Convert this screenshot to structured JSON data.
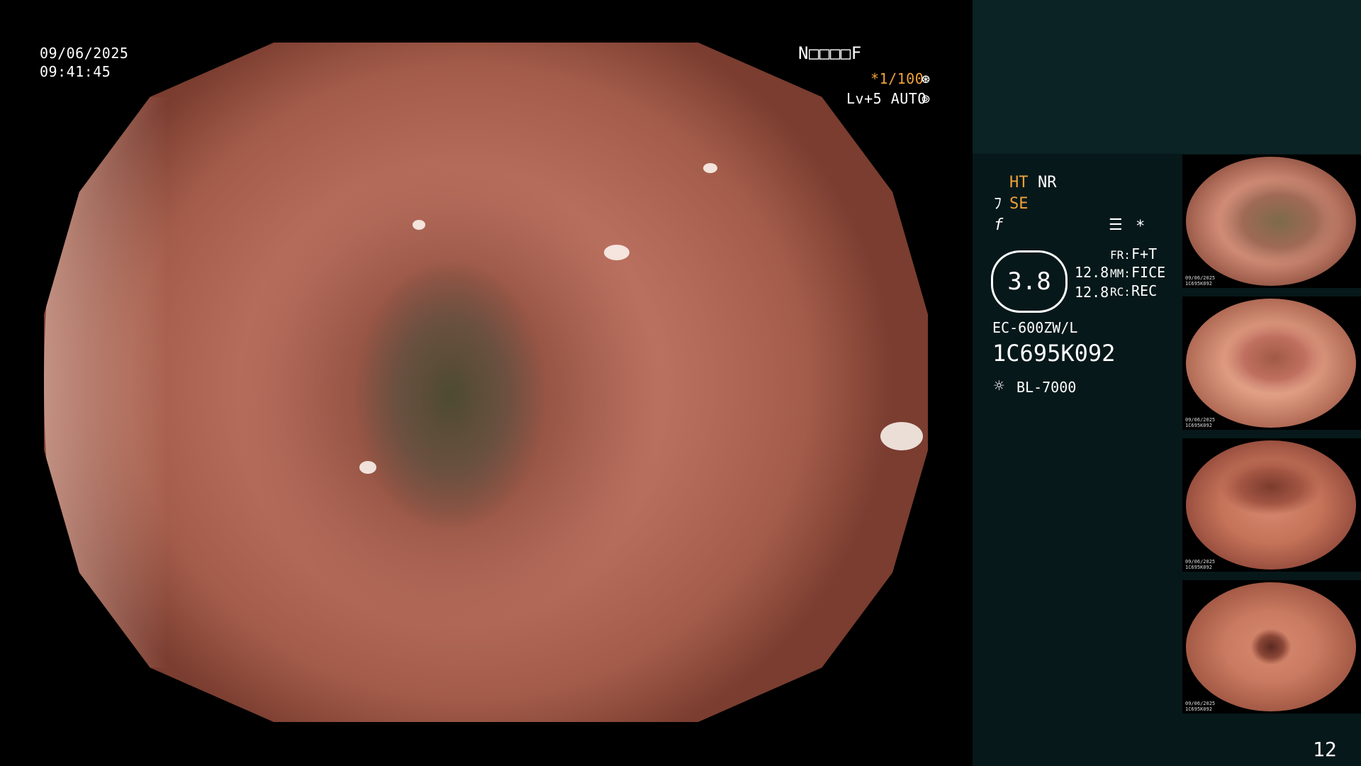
{
  "osd": {
    "date": "09/06/2025",
    "time": "09:41:45",
    "patient_name": "N□□□□F",
    "shutter": "*1/100",
    "shutter_icon": "aperture-icon",
    "level": "Lv+5 AUTO",
    "level_icon": "iris-icon"
  },
  "side": {
    "ht": "HT",
    "nr": "NR",
    "se_prefix": "ﾌ",
    "se": "SE",
    "f_mark": "f",
    "menu_icon": "settings-list-icon",
    "asterisk": "*",
    "zoom": "3.8",
    "fr_value1": "12.8",
    "fr_value2": "12.8",
    "fr_label": "FR:",
    "fr": "F+T",
    "mm_label": "MM:",
    "mm": "FICE",
    "rc_label": "RC:",
    "rc": "REC",
    "scope_model": "EC-600ZW/L",
    "scope_serial": "1C695K092",
    "light_source": "BL-7000",
    "light_icon": "lamp-icon"
  },
  "thumbnails": [
    {
      "caption": "09/06/2025\n1C695K092"
    },
    {
      "caption": "09/06/2025\n1C695K092"
    },
    {
      "caption": "09/06/2025\n1C695K092"
    },
    {
      "caption": "09/06/2025\n1C695K092"
    }
  ],
  "page_number": "12",
  "colors": {
    "accent": "#f0a23a",
    "panel": "#07181a",
    "panel_top": "#0b2325"
  }
}
